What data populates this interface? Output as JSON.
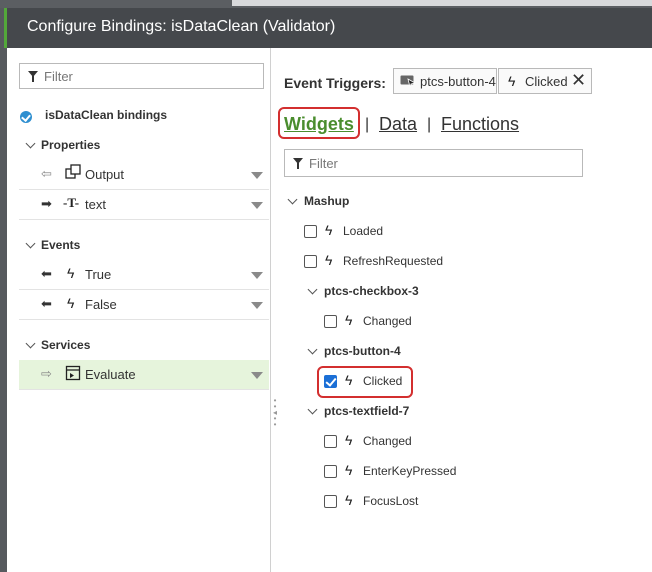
{
  "title": "Configure Bindings: isDataClean (Validator)",
  "left": {
    "filter_placeholder": "Filter",
    "root_label": "isDataClean bindings",
    "sections": {
      "properties": "Properties",
      "events": "Events",
      "services": "Services"
    },
    "properties": [
      {
        "label": "Output",
        "icon": "output-widget-icon"
      },
      {
        "label": "text",
        "icon": "text-type-icon"
      }
    ],
    "events": [
      {
        "label": "True",
        "icon": "lightning-icon"
      },
      {
        "label": "False",
        "icon": "lightning-icon"
      }
    ],
    "services": [
      {
        "label": "Evaluate",
        "icon": "service-icon"
      }
    ]
  },
  "right": {
    "event_triggers_label": "Event Triggers:",
    "trigger_widget": "ptcs-button-4",
    "trigger_event": "Clicked",
    "tabs": {
      "widgets": "Widgets",
      "data": "Data",
      "functions": "Functions"
    },
    "filter_placeholder": "Filter",
    "tree": {
      "mashup": "Mashup",
      "mashup_events": [
        "Loaded",
        "RefreshRequested"
      ],
      "checkbox": {
        "name": "ptcs-checkbox-3",
        "events": [
          "Changed"
        ]
      },
      "button": {
        "name": "ptcs-button-4",
        "events": [
          "Clicked"
        ]
      },
      "textfield": {
        "name": "ptcs-textfield-7",
        "events": [
          "Changed",
          "EnterKeyPressed",
          "FocusLost"
        ]
      }
    }
  },
  "colors": {
    "accent_green": "#4a8d2e",
    "highlight_red": "#d32f2f",
    "checkbox_blue": "#1b6fd6",
    "titlebar": "#45484c"
  }
}
